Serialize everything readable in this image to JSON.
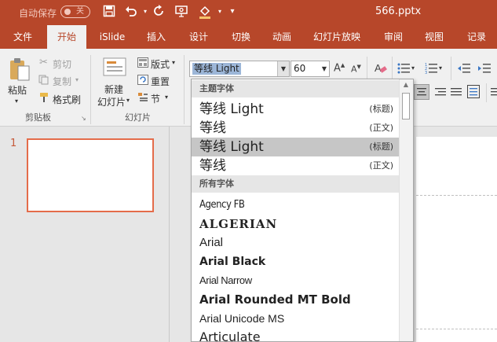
{
  "titlebar": {
    "autosave_label": "自动保存",
    "autosave_state": "关",
    "doc_title": "566.pptx",
    "qat_icons": [
      "save-icon",
      "undo-icon",
      "redo-icon",
      "present-icon",
      "paint-bucket-icon",
      "customize-qat-icon"
    ]
  },
  "tabs": [
    "文件",
    "开始",
    "iSlide",
    "插入",
    "设计",
    "切换",
    "动画",
    "幻灯片放映",
    "审阅",
    "视图",
    "记录"
  ],
  "active_tab": "开始",
  "clipboard": {
    "paste": "粘贴",
    "cut": "剪切",
    "copy": "复制",
    "format_painter": "格式刷",
    "group_label": "剪贴板"
  },
  "slides_group": {
    "new_slide_line1": "新建",
    "new_slide_line2": "幻灯片",
    "layout": "版式",
    "reset": "重置",
    "section": "节",
    "group_label": "幻灯片"
  },
  "font": {
    "name": "等线 Light",
    "size": "60"
  },
  "font_dropdown": {
    "theme_header": "主题字体",
    "theme_fonts": [
      {
        "name": "等线 Light",
        "tag": "(标题)"
      },
      {
        "name": "等线",
        "tag": "(正文)"
      },
      {
        "name": "等线 Light",
        "tag": "(标题)"
      },
      {
        "name": "等线",
        "tag": "(正文)"
      }
    ],
    "all_header": "所有字体",
    "all_fonts": [
      "Agency FB",
      "ALGERIAN",
      "Arial",
      "Arial Black",
      "Arial Narrow",
      "Arial Rounded MT Bold",
      "Arial Unicode MS",
      "Articulate"
    ]
  },
  "slide_panel": {
    "slide_number": "1"
  },
  "colors": {
    "brand": "#b7472a",
    "selection": "#c6c6c6",
    "thumb_border": "#e46c4a"
  }
}
